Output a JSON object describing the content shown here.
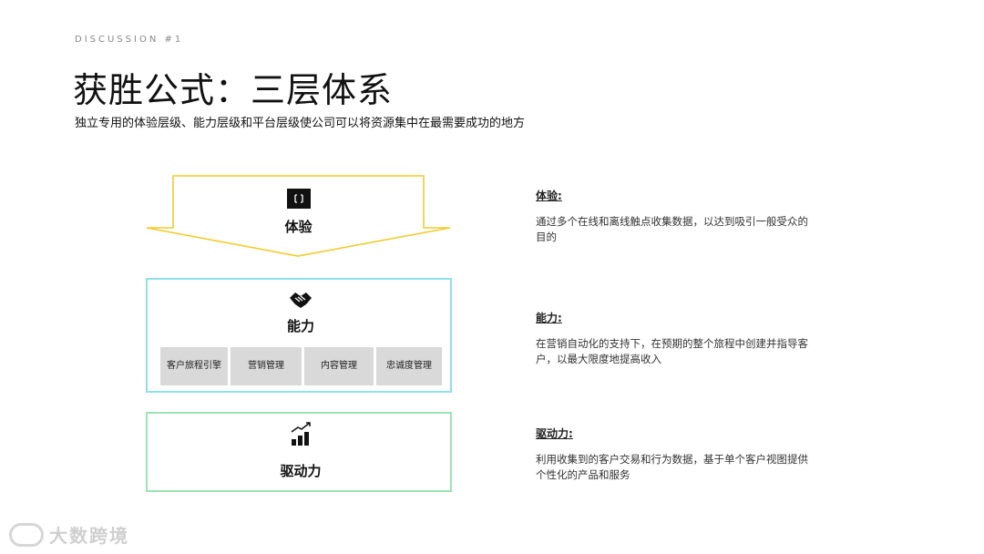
{
  "header": {
    "eyebrow": "DISCUSSION #1",
    "title": "获胜公式：三层体系",
    "subtitle": "独立专用的体验层级、能力层级和平台层级使公司可以将资源集中在最需要成功的地方"
  },
  "diagram": {
    "experience": {
      "label": "体验",
      "icon": "screen-frame-icon",
      "color": "#f2cc2e"
    },
    "capability": {
      "label": "能力",
      "icon": "handshake-icon",
      "color": "#8fe0e8",
      "items": [
        "客户旅程引擎",
        "营销管理",
        "内容管理",
        "忠诚度管理"
      ]
    },
    "driver": {
      "label": "驱动力",
      "icon": "growth-chart-icon",
      "color": "#9de3b6"
    }
  },
  "descriptions": [
    {
      "heading": "体验:",
      "text": "通过多个在线和离线触点收集数据，以达到吸引一般受众的目的"
    },
    {
      "heading": "能力:",
      "text": "在营销自动化的支持下，在预期的整个旅程中创建并指导客户，以最大限度地提高收入"
    },
    {
      "heading": "驱动力:",
      "text": "利用收集到的客户交易和行为数据，基于单个客户视图提供个性化的产品和服务"
    }
  ],
  "watermark": {
    "text": "大数跨境"
  }
}
